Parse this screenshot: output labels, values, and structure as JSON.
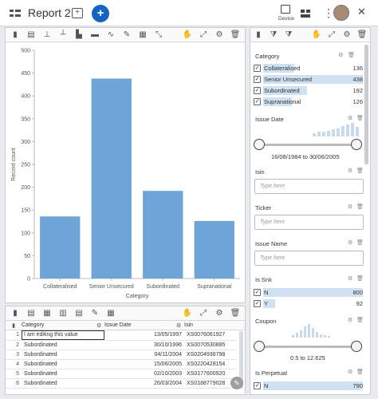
{
  "app": {
    "title": "Report 2",
    "device_label": "Device"
  },
  "chart_data": {
    "type": "bar",
    "categories": [
      "Collateralised",
      "Senior Unsecured",
      "Subordinated",
      "Supranational"
    ],
    "values": [
      136,
      438,
      192,
      126
    ],
    "title": "",
    "xlabel": "Category",
    "ylabel": "Record count",
    "ylim": [
      0,
      500
    ],
    "yticks": [
      0,
      50,
      100,
      150,
      200,
      250,
      300,
      350,
      400,
      450,
      500
    ],
    "grid": false,
    "bar_color": "#6fa5d6"
  },
  "filters": {
    "category": {
      "title": "Category",
      "items": [
        {
          "label": "Collateralised",
          "count": "136",
          "frac": 0.31
        },
        {
          "label": "Senior Unsecured",
          "count": "438",
          "frac": 1.0
        },
        {
          "label": "Subordinated",
          "count": "192",
          "frac": 0.44
        },
        {
          "label": "Supranational",
          "count": "126",
          "frac": 0.29
        }
      ]
    },
    "issue_date": {
      "title": "Issue Date",
      "range": "16/08/1984 to 30/06/2005"
    },
    "isin": {
      "title": "Isin",
      "placeholder": "Type here"
    },
    "ticker": {
      "title": "Ticker",
      "placeholder": "Type here"
    },
    "issue_name": {
      "title": "Issue Name",
      "placeholder": "Type here"
    },
    "is_snk": {
      "title": "Is Snk",
      "items": [
        {
          "label": "N",
          "count": "800",
          "frac": 1.0
        },
        {
          "label": "Y",
          "count": "92",
          "frac": 0.12
        }
      ]
    },
    "coupon": {
      "title": "Coupon",
      "range": "0.5 to 12.625"
    },
    "is_perpetual": {
      "title": "Is Perpetual",
      "items": [
        {
          "label": "N",
          "count": "790",
          "frac": 1.0
        }
      ]
    }
  },
  "table": {
    "columns": [
      "Category",
      "Issue Date",
      "Isin"
    ],
    "rows": [
      {
        "n": "1",
        "category": "I am editing this value",
        "date": "13/05/1997",
        "isin": "XS0076061927"
      },
      {
        "n": "2",
        "category": "Subordinated",
        "date": "30/10/1996",
        "isin": "XS0070530885"
      },
      {
        "n": "3",
        "category": "Subordinated",
        "date": "04/11/2004",
        "isin": "XS0204938798"
      },
      {
        "n": "4",
        "category": "Subordinated",
        "date": "15/06/2005",
        "isin": "XS0220428154"
      },
      {
        "n": "5",
        "category": "Subordinated",
        "date": "02/10/2003",
        "isin": "XS0177600920"
      },
      {
        "n": "6",
        "category": "Subordinated",
        "date": "26/03/2004",
        "isin": "XS0188779028"
      }
    ]
  },
  "colors": {
    "accent": "#1565c0",
    "bar": "#6fa5d6",
    "filter_bar": "#cfe1f3",
    "histogram": "#c8daea"
  }
}
